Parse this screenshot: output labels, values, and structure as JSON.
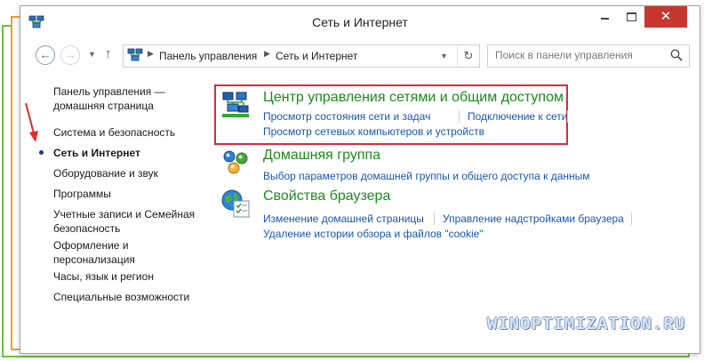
{
  "window": {
    "title": "Сеть и Интернет",
    "close_glyph": "✕"
  },
  "address": {
    "crumbs": [
      "Панель управления",
      "Сеть и Интернет"
    ],
    "search_placeholder": "Поиск в панели управления"
  },
  "leftnav": {
    "items": [
      {
        "lines": [
          "Панель управления —",
          "домашняя страница"
        ]
      },
      {
        "lines": [
          "Система и безопасность"
        ]
      },
      {
        "lines": [
          "Сеть и Интернет"
        ],
        "current": true
      },
      {
        "lines": [
          "Оборудование и звук"
        ]
      },
      {
        "lines": [
          "Программы"
        ]
      },
      {
        "lines": [
          "Учетные записи и Семейная",
          "безопасность"
        ]
      },
      {
        "lines": [
          "Оформление и",
          "персонализация"
        ]
      },
      {
        "lines": [
          "Часы, язык и регион"
        ]
      },
      {
        "lines": [
          "Специальные возможности"
        ]
      }
    ]
  },
  "categories": [
    {
      "title": "Центр управления сетями и общим доступом",
      "icon": "network-center-icon",
      "links": [
        "Просмотр состояния сети и задач",
        "Подключение к сети",
        "Просмотр сетевых компьютеров и устройств"
      ]
    },
    {
      "title": "Домашняя группа",
      "icon": "homegroup-icon",
      "links": [
        "Выбор параметров домашней группы и общего доступа к данным"
      ]
    },
    {
      "title": "Свойства браузера",
      "icon": "internet-options-icon",
      "links": [
        "Изменение домашней страницы",
        "Управление надстройками браузера",
        "Удаление истории обзора и файлов \"cookie\""
      ]
    }
  ],
  "watermark": "WINOPTIMIZATION.RU",
  "colors": {
    "category_title": "#1d8a1d",
    "link": "#1a56b3",
    "highlight": "#e0283a",
    "close_button": "#c7372f"
  }
}
